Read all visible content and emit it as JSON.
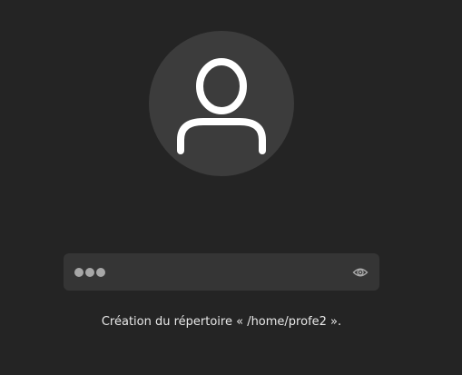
{
  "login": {
    "avatar_icon": "user-avatar-icon",
    "password": {
      "masked_length": 3,
      "reveal_icon": "eye-icon"
    },
    "status_message": "Création du répertoire « /home/profe2 »."
  },
  "colors": {
    "background": "#242424",
    "avatar_circle": "#3c3c3c",
    "field": "#353535",
    "text": "#e8e8e8"
  }
}
